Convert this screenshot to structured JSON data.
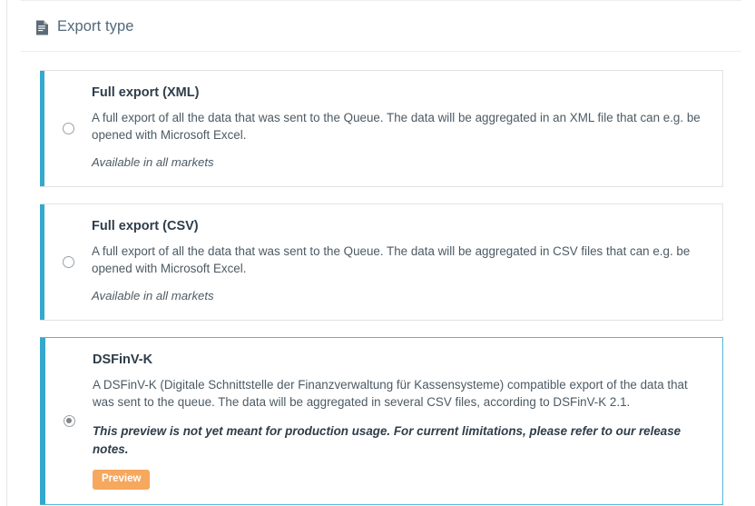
{
  "header": {
    "icon": "document-icon",
    "title": "Export type"
  },
  "colors": {
    "accent": "#35a8ce",
    "selected_border": "#56b4d9",
    "badge": "#f5a85e",
    "title_text": "#2e3d49",
    "header_text": "#51687a"
  },
  "options": [
    {
      "id": "full-export-xml",
      "title": "Full export (XML)",
      "description": "A full export of all the data that was sent to the Queue. The data will be aggregated in an XML file that can e.g. be opened with Microsoft Excel.",
      "note": "Available in all markets",
      "selected": false
    },
    {
      "id": "full-export-csv",
      "title": "Full export (CSV)",
      "description": "A full export of all the data that was sent to the Queue. The data will be aggregated in CSV files that can e.g. be opened with Microsoft Excel.",
      "note": "Available in all markets",
      "selected": false
    },
    {
      "id": "dsfinv-k",
      "title": "DSFinV-K",
      "description": "A DSFinV-K (Digitale Schnittstelle der Finanzverwaltung für Kassensysteme) compatible export of the data that was sent to the queue. The data will be aggregated in several CSV files, according to DSFinV-K 2.1.",
      "warning": "This preview is not yet meant for production usage. For current limitations, please refer to our release notes.",
      "badge": "Preview",
      "selected": true
    }
  ]
}
